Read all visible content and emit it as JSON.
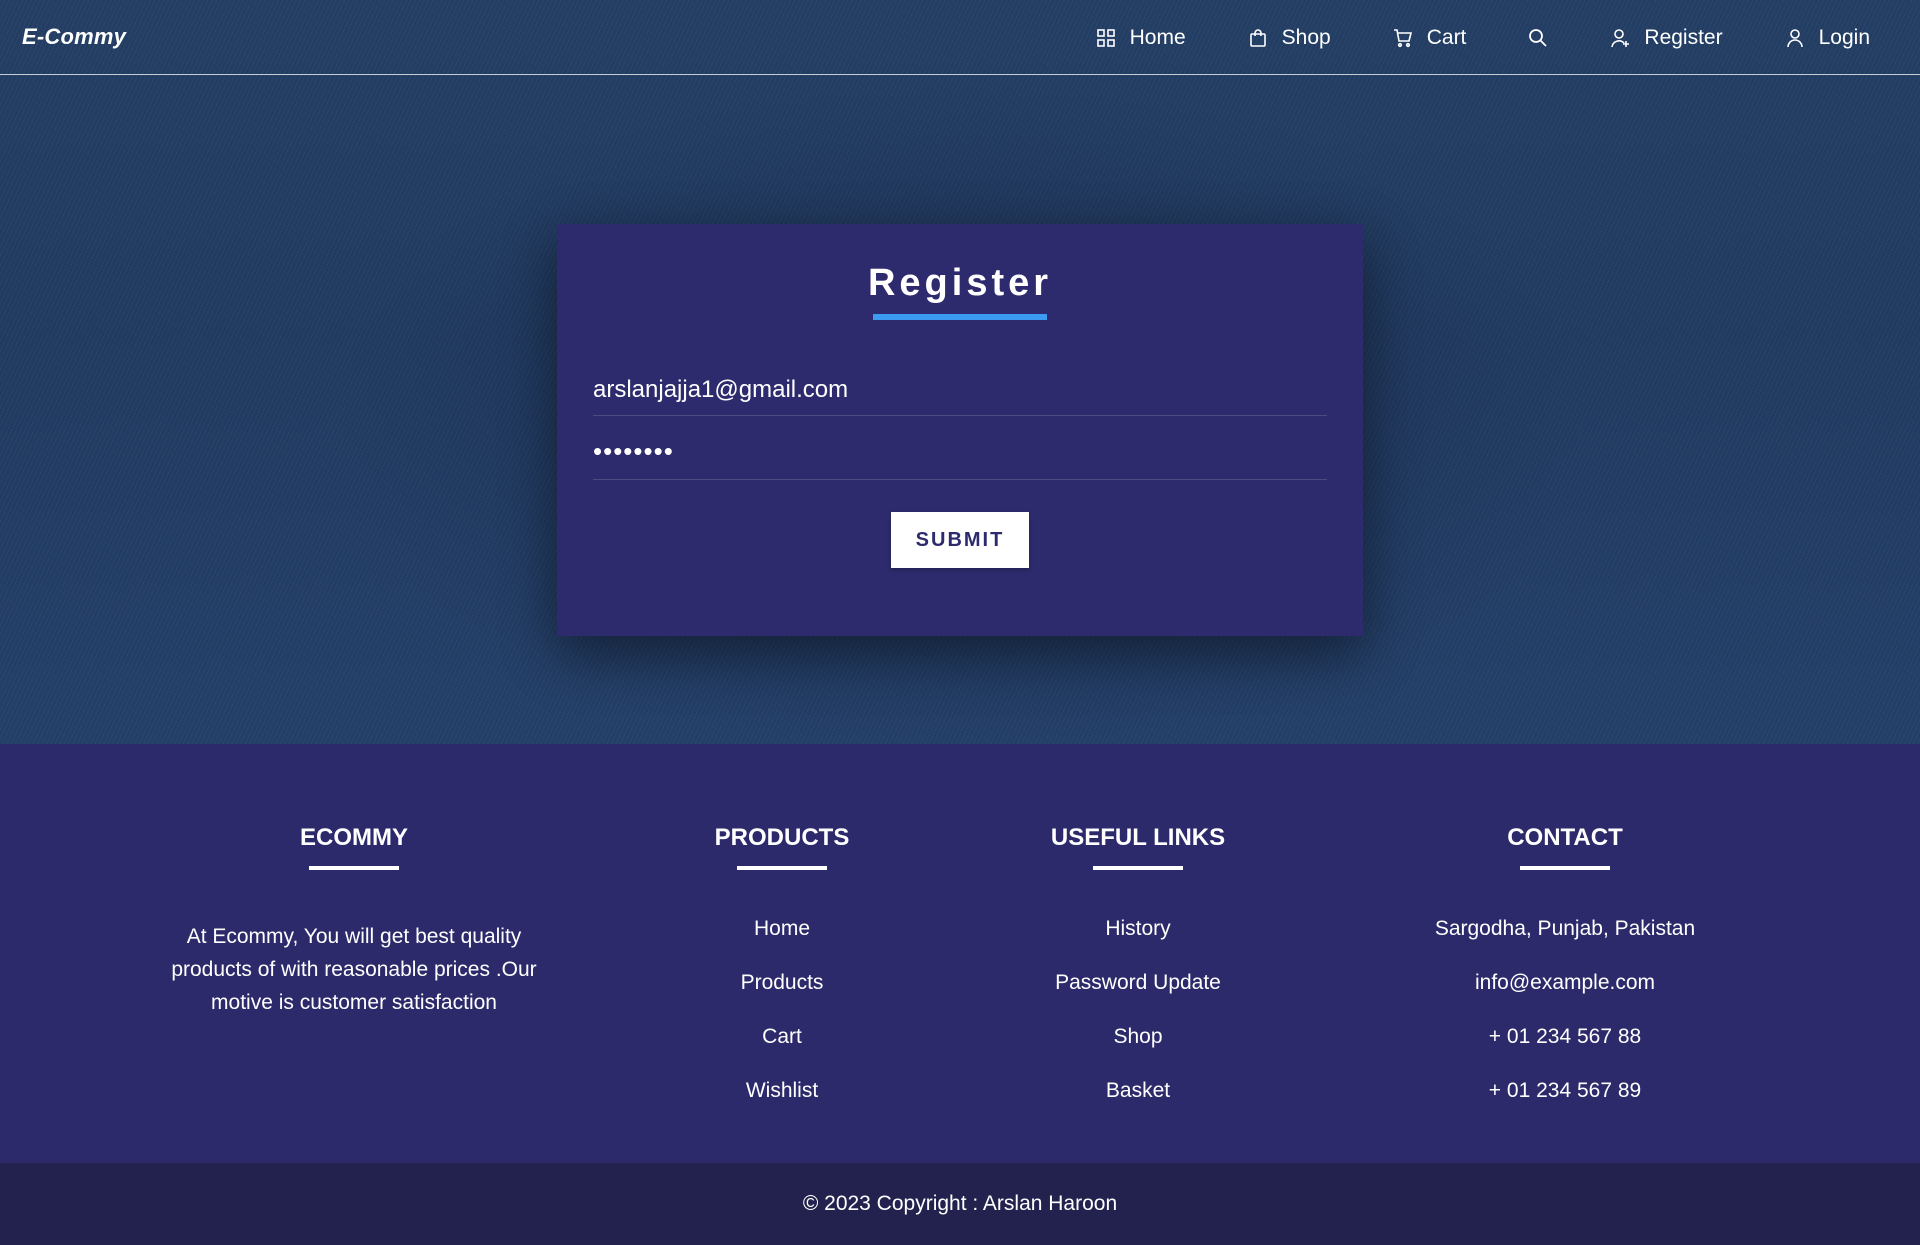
{
  "brand": "E-Commy",
  "nav": {
    "home": "Home",
    "shop": "Shop",
    "cart": "Cart",
    "register": "Register",
    "login": "Login"
  },
  "icons": {
    "home": "grid-icon",
    "shop": "shopping-bag-icon",
    "cart": "cart-icon",
    "search": "search-icon",
    "register": "user-plus-icon",
    "login": "user-icon"
  },
  "form": {
    "title": "Register",
    "email_value": "arslanjajja1@gmail.com",
    "password_masked": "••••••••",
    "submit_label": "SUBMIT"
  },
  "footer": {
    "about": {
      "heading": "ECOMMY",
      "text": "At Ecommy, You will get best quality products of with reasonable prices .Our motive is customer satisfaction"
    },
    "products": {
      "heading": "PRODUCTS",
      "items": [
        "Home",
        "Products",
        "Cart",
        "Wishlist"
      ]
    },
    "useful_links": {
      "heading": "USEFUL LINKS",
      "items": [
        "History",
        "Password Update",
        "Shop",
        "Basket"
      ]
    },
    "contact": {
      "heading": "CONTACT",
      "items": [
        "Sargodha, Punjab, Pakistan",
        "info@example.com",
        "+ 01 234 567 88",
        "+ 01 234 567 89"
      ]
    }
  },
  "copyright": "© 2023 Copyright : Arslan Haroon",
  "colors": {
    "accent": "#3a9bf0",
    "card_bg": "#2d2b6d",
    "footer_bg": "#2c2a6a",
    "copyright_bg": "#23224f"
  }
}
